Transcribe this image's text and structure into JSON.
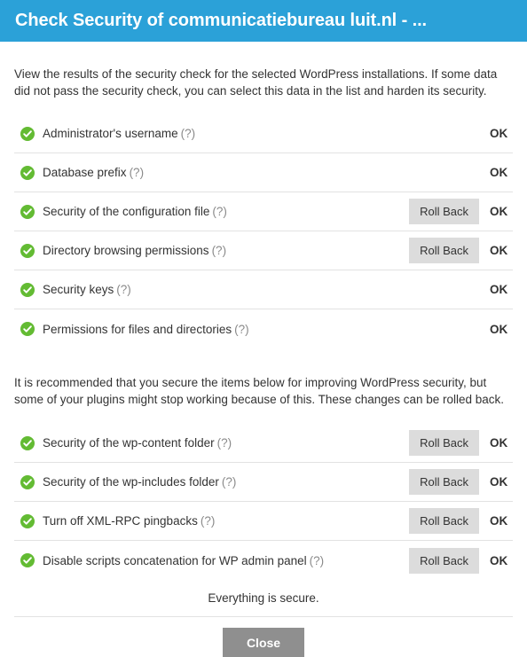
{
  "titlebar": {
    "title": "Check Security of communicatiebureau luit.nl - ...",
    "accent_color": "#2ba1d8"
  },
  "intro": "View the results of the security check for the selected WordPress installations. If some data did not pass the security check, you can select this data in the list and harden its security.",
  "section_note": "It is recommended that you secure the items below for improving WordPress security, but some of your plugins might stop working because of this. These changes can be rolled back.",
  "help_label": "(?)",
  "rollback_label": "Roll Back",
  "status_ok": "OK",
  "ok_icon_color": "#63bb33",
  "primary_group": [
    {
      "label": "Administrator's username",
      "help": "(?)",
      "rollback": false,
      "status": "OK"
    },
    {
      "label": "Database prefix",
      "help": "(?)",
      "rollback": false,
      "status": "OK"
    },
    {
      "label": "Security of the configuration file",
      "help": "(?)",
      "rollback": true,
      "status": "OK"
    },
    {
      "label": "Directory browsing permissions",
      "help": "(?)",
      "rollback": true,
      "status": "OK"
    },
    {
      "label": "Security keys",
      "help": "(?)",
      "rollback": false,
      "status": "OK"
    },
    {
      "label": "Permissions for files and directories",
      "help": "(?)",
      "rollback": false,
      "status": "OK"
    }
  ],
  "secondary_group": [
    {
      "label": "Security of the wp-content folder",
      "help": "(?)",
      "rollback": true,
      "status": "OK"
    },
    {
      "label": "Security of the wp-includes folder",
      "help": "(?)",
      "rollback": true,
      "status": "OK"
    },
    {
      "label": "Turn off XML-RPC pingbacks",
      "help": "(?)",
      "rollback": true,
      "status": "OK"
    },
    {
      "label": "Disable scripts concatenation for WP admin panel",
      "help": "(?)",
      "rollback": true,
      "status": "OK"
    }
  ],
  "secure_note": "Everything is secure.",
  "footer": {
    "close_label": "Close",
    "close_color": "#8f8f8f"
  }
}
